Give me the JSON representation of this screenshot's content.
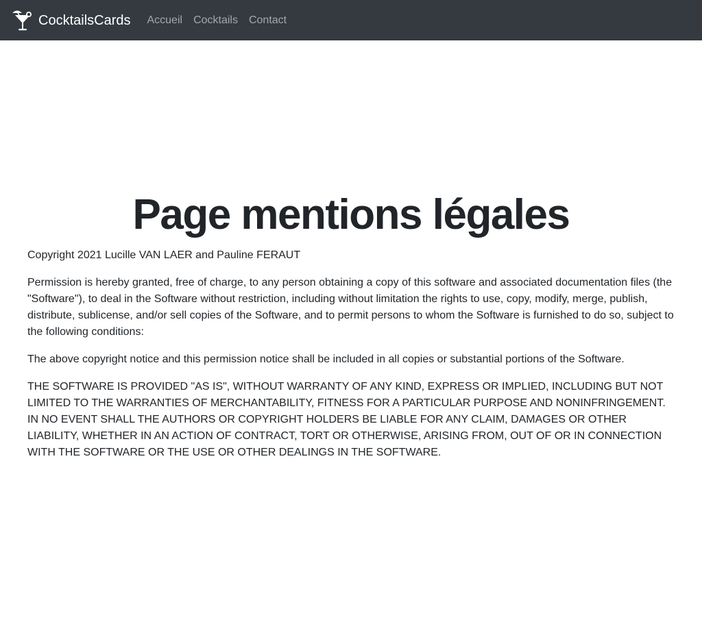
{
  "navbar": {
    "brand": "CocktailsCards",
    "brand_icon": "cocktail-glass-icon",
    "links": [
      "Accueil",
      "Cocktails",
      "Contact"
    ]
  },
  "main": {
    "title": "Page mentions légales",
    "paragraphs": [
      "Copyright 2021 Lucille VAN LAER and Pauline FERAUT",
      "Permission is hereby granted, free of charge, to any person obtaining a copy of this software and associated documentation files (the \"Software\"), to deal in the Software without restriction, including without limitation the rights to use, copy, modify, merge, publish, distribute, sublicense, and/or sell copies of the Software, and to permit persons to whom the Software is furnished to do so, subject to the following conditions:",
      "The above copyright notice and this permission notice shall be included in all copies or substantial portions of the Software.",
      "THE SOFTWARE IS PROVIDED \"AS IS\", WITHOUT WARRANTY OF ANY KIND, EXPRESS OR IMPLIED, INCLUDING BUT NOT LIMITED TO THE WARRANTIES OF MERCHANTABILITY, FITNESS FOR A PARTICULAR PURPOSE AND NONINFRINGEMENT. IN NO EVENT SHALL THE AUTHORS OR COPYRIGHT HOLDERS BE LIABLE FOR ANY CLAIM, DAMAGES OR OTHER LIABILITY, WHETHER IN AN ACTION OF CONTRACT, TORT OR OTHERWISE, ARISING FROM, OUT OF OR IN CONNECTION WITH THE SOFTWARE OR THE USE OR OTHER DEALINGS IN THE SOFTWARE."
    ]
  },
  "colors": {
    "navbar_bg": "#343a40",
    "text": "#212529",
    "nav_link": "rgba(255,255,255,0.55)"
  }
}
